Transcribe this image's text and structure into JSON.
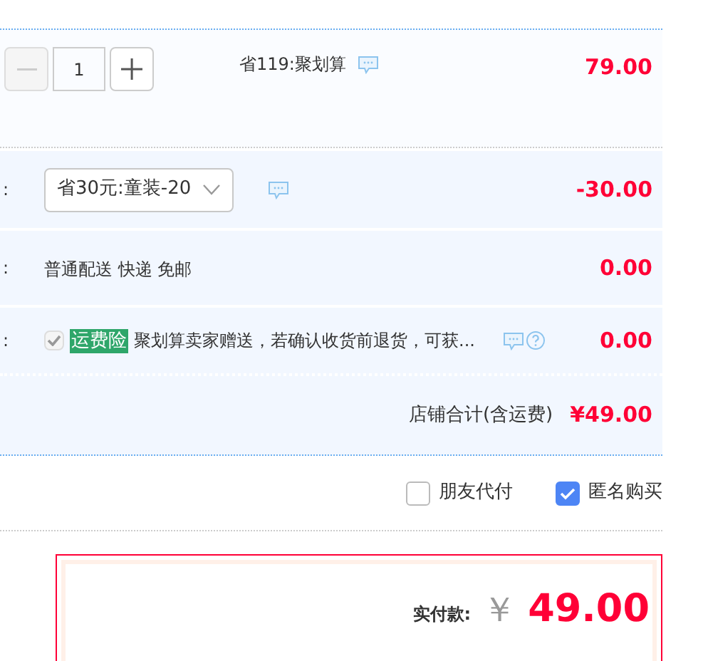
{
  "item": {
    "quantity": "1",
    "promo": "省119:聚划算",
    "price": "79.00"
  },
  "rows": [
    {
      "kind": "coupon",
      "label": ":",
      "value": "省30元:童装-20",
      "amount": "-30.00"
    },
    {
      "kind": "shipping",
      "label": ":",
      "value": "普通配送 快递 免邮",
      "amount": "0.00"
    },
    {
      "kind": "insurance",
      "label": ":",
      "checked": true,
      "disabled": true,
      "tag": "运费险",
      "value": "聚划算卖家赠送，若确认收货前退货，可获...",
      "amount": "0.00"
    }
  ],
  "store_total": {
    "label": "店铺合计(含运费)",
    "amount": "¥49.00"
  },
  "options": [
    {
      "label": "朋友代付",
      "checked": false
    },
    {
      "label": "匿名购买",
      "checked": true
    }
  ],
  "payment": {
    "label": "实付款:",
    "currency": "￥",
    "amount": "49.00"
  }
}
